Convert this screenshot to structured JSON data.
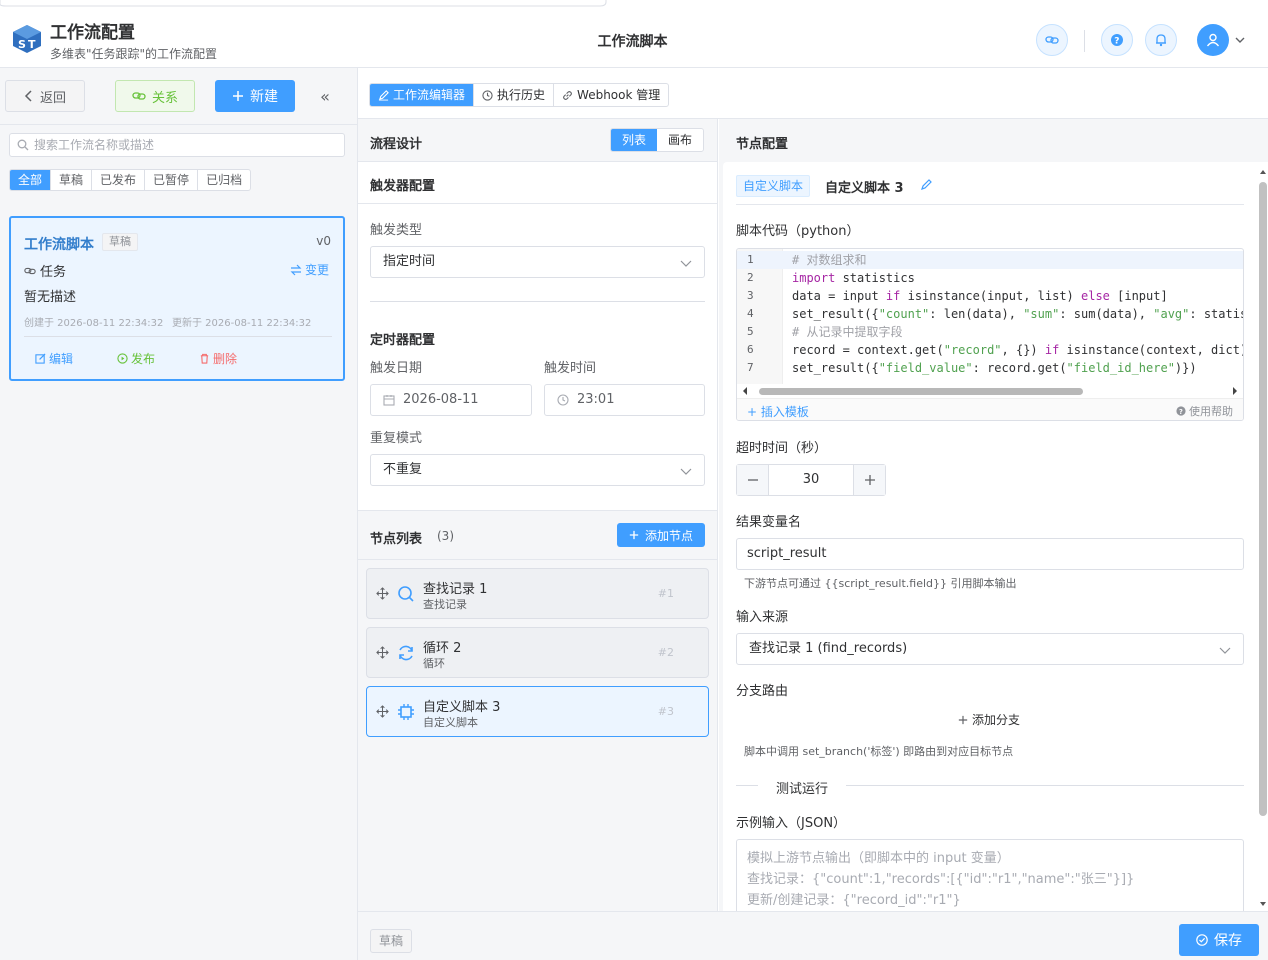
{
  "header": {
    "app_title": "工作流配置",
    "app_subtitle": "多维表\"任务跟踪\"的工作流配置",
    "center_title": "工作流脚本"
  },
  "sidebar": {
    "back_label": "返回",
    "relations_label": "关系",
    "new_label": "新建",
    "collapse_glyph": "«",
    "search_placeholder": "搜索工作流名称或描述",
    "filters": [
      "全部",
      "草稿",
      "已发布",
      "已暂停",
      "已归档"
    ],
    "active_filter": "全部",
    "workflow": {
      "name": "工作流脚本",
      "status": "草稿",
      "version": "v0",
      "table": "任务",
      "trigger": "变更",
      "description": "暂无描述",
      "created": "创建于 2026-08-11 22:34:32",
      "updated": "更新于 2026-08-11 22:34:32",
      "edit_label": "编辑",
      "publish_label": "发布",
      "delete_label": "删除"
    }
  },
  "tabs": [
    {
      "label": "工作流编辑器",
      "icon": "pencil-icon",
      "active": true
    },
    {
      "label": "执行历史",
      "icon": "clock-icon",
      "active": false
    },
    {
      "label": "Webhook 管理",
      "icon": "link-icon",
      "active": false
    }
  ],
  "flow_design": {
    "title": "流程设计",
    "view_list": "列表",
    "view_canvas": "画布",
    "trigger_title": "触发器配置",
    "trigger_type_label": "触发类型",
    "trigger_type_value": "指定时间",
    "timer_title": "定时器配置",
    "date_label": "触发日期",
    "date_value": "2026-08-11",
    "time_label": "触发时间",
    "time_value": "23:01",
    "repeat_label": "重复模式",
    "repeat_value": "不重复",
    "nodes_title": "节点列表",
    "nodes_count": "(3)",
    "add_node_label": "添加节点",
    "nodes": [
      {
        "name": "查找记录 1",
        "type": "查找记录",
        "index": "#1",
        "icon": "search-icon"
      },
      {
        "name": "循环 2",
        "type": "循环",
        "index": "#2",
        "icon": "loop-icon"
      },
      {
        "name": "自定义脚本 3",
        "type": "自定义脚本",
        "index": "#3",
        "icon": "chip-icon"
      }
    ]
  },
  "node_config": {
    "title": "节点配置",
    "type_tag": "自定义脚本",
    "node_title": "自定义脚本 3",
    "code_label": "脚本代码（python）",
    "code_lines": [
      {
        "n": "1",
        "comment": "# 对数组求和"
      },
      {
        "n": "2",
        "kw1": "import",
        "rest": " statistics"
      },
      {
        "n": "3",
        "a": "data = input ",
        "kw1": "if",
        "b": " isinstance(input, list) ",
        "kw2": "else",
        "c": " [input]"
      },
      {
        "n": "4",
        "a": "set_result({",
        "s1": "\"count\"",
        "b": ": len(data), ",
        "s2": "\"sum\"",
        "c": ": sum(data), ",
        "s3": "\"avg\"",
        "d": ": statis"
      },
      {
        "n": "5",
        "comment": "# 从记录中提取字段"
      },
      {
        "n": "6",
        "a": "record = context.get(",
        "s1": "\"record\"",
        "b": ", {}) ",
        "kw1": "if",
        "c": " isinstance(context, dict)"
      },
      {
        "n": "7",
        "a": "set_result({",
        "s1": "\"field_value\"",
        "b": ": record.get(",
        "s2": "\"field_id_here\"",
        "c": ")})"
      }
    ],
    "insert_template": "+ 插入模板",
    "use_help": "使用帮助",
    "timeout_label": "超时时间（秒）",
    "timeout_value": "30",
    "result_var_label": "结果变量名",
    "result_var_value": "script_result",
    "result_hint": "下游节点可通过 {{script_result.field}} 引用脚本输出",
    "input_source_label": "输入来源",
    "input_source_value": "查找记录 1 (find_records)",
    "branch_label": "分支路由",
    "add_branch_label": "添加分支",
    "branch_hint": "脚本中调用 set_branch('标签') 即路由到对应目标节点",
    "test_run_label": "测试运行",
    "sample_input_label": "示例输入（JSON）",
    "sample_placeholder": "模拟上游节点输出（即脚本中的 input 变量）\n查找记录：{\"count\":1,\"records\":[{\"id\":\"r1\",\"name\":\"张三\"}]}\n更新/创建记录：{\"record_id\":\"r1\"}"
  },
  "footer": {
    "status_badge": "草稿",
    "save_label": "保存"
  },
  "colors": {
    "primary": "#409eff",
    "success": "#67c23a",
    "danger": "#f56c6c"
  }
}
